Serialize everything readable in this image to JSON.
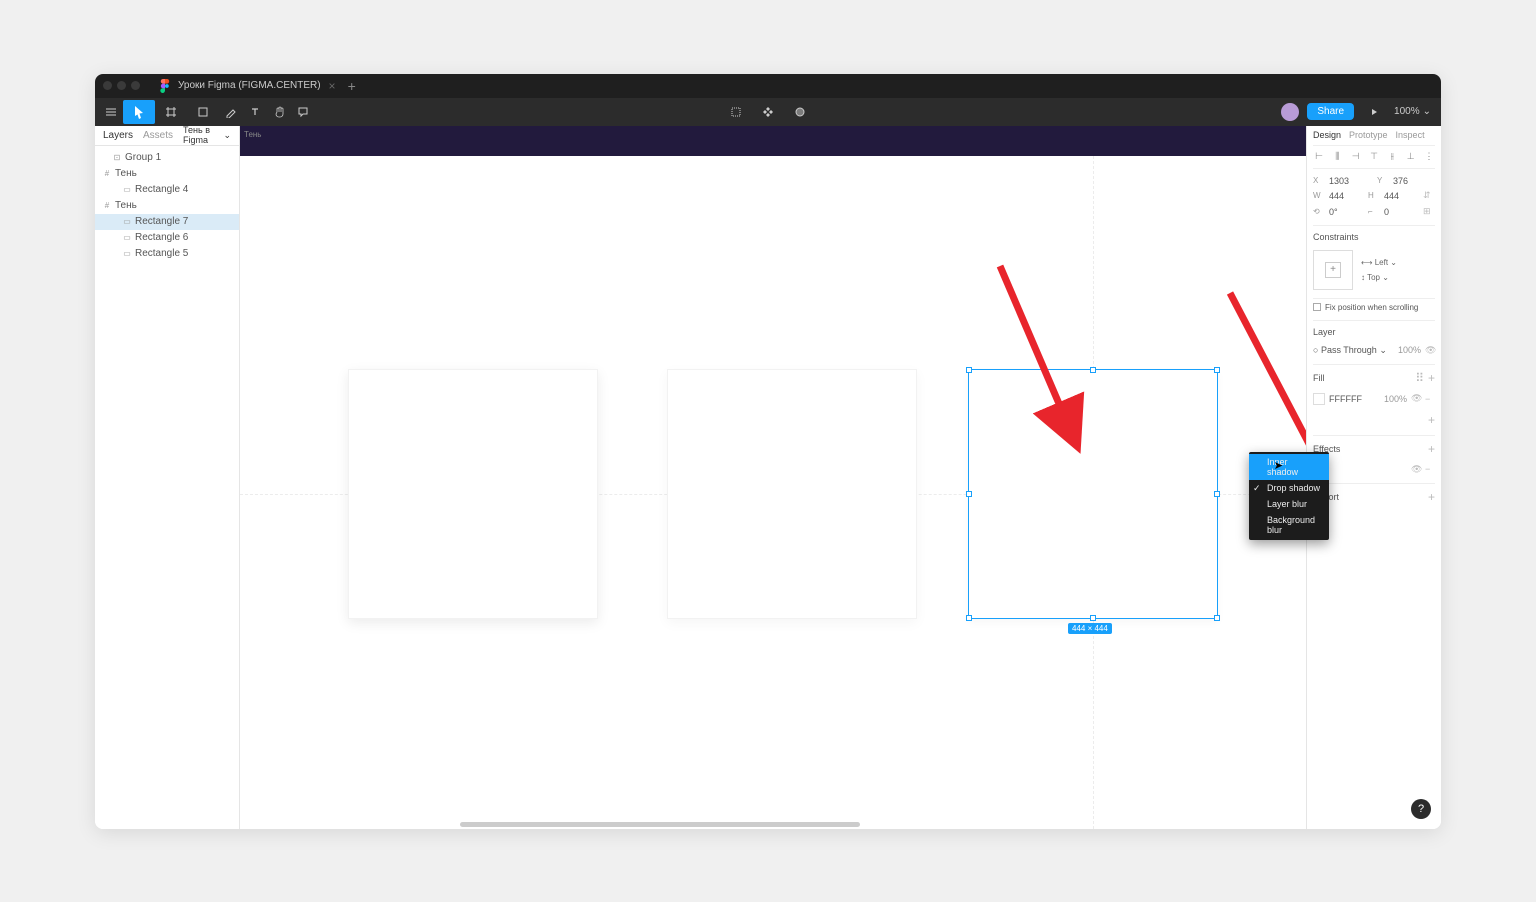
{
  "titlebar": {
    "tab_title": "Уроки Figma (FIGMA.CENTER)"
  },
  "toolbar": {
    "zoom_label": "100%",
    "share_label": "Share"
  },
  "left_panel": {
    "tab_layers": "Layers",
    "tab_assets": "Assets",
    "page_name": "Тень в Figma",
    "layers": [
      {
        "name": "Group 1",
        "indent": 1,
        "icon": "group"
      },
      {
        "name": "Тень",
        "indent": 0,
        "icon": "frame"
      },
      {
        "name": "Rectangle 4",
        "indent": 2,
        "icon": "rect"
      },
      {
        "name": "Тень",
        "indent": 0,
        "icon": "frame"
      },
      {
        "name": "Rectangle 7",
        "indent": 2,
        "icon": "rect",
        "selected": true
      },
      {
        "name": "Rectangle 6",
        "indent": 2,
        "icon": "rect"
      },
      {
        "name": "Rectangle 5",
        "indent": 2,
        "icon": "rect"
      }
    ]
  },
  "canvas": {
    "frame_label": "Тень",
    "dimensions_badge": "444 × 444"
  },
  "right_panel": {
    "tab_design": "Design",
    "tab_prototype": "Prototype",
    "tab_inspect": "Inspect",
    "x_label": "X",
    "x_value": "1303",
    "y_label": "Y",
    "y_value": "376",
    "w_label": "W",
    "w_value": "444",
    "h_label": "H",
    "h_value": "444",
    "rot_label": "",
    "rot_value": "0°",
    "radius_value": "0",
    "constraints_title": "Constraints",
    "constraint_h": "Left",
    "constraint_v": "Top",
    "fix_scroll_label": "Fix position when scrolling",
    "layer_title": "Layer",
    "blend_mode": "Pass Through",
    "layer_opacity": "100%",
    "fill_title": "Fill",
    "fill_hex": "FFFFFF",
    "fill_opacity": "100%",
    "effects_title": "Effects",
    "export_title": "Export"
  },
  "effects_dropdown": {
    "items": [
      {
        "label": "Inner shadow",
        "highlighted": true
      },
      {
        "label": "Drop shadow",
        "checked": true
      },
      {
        "label": "Layer blur"
      },
      {
        "label": "Background blur"
      }
    ]
  },
  "help": "?"
}
